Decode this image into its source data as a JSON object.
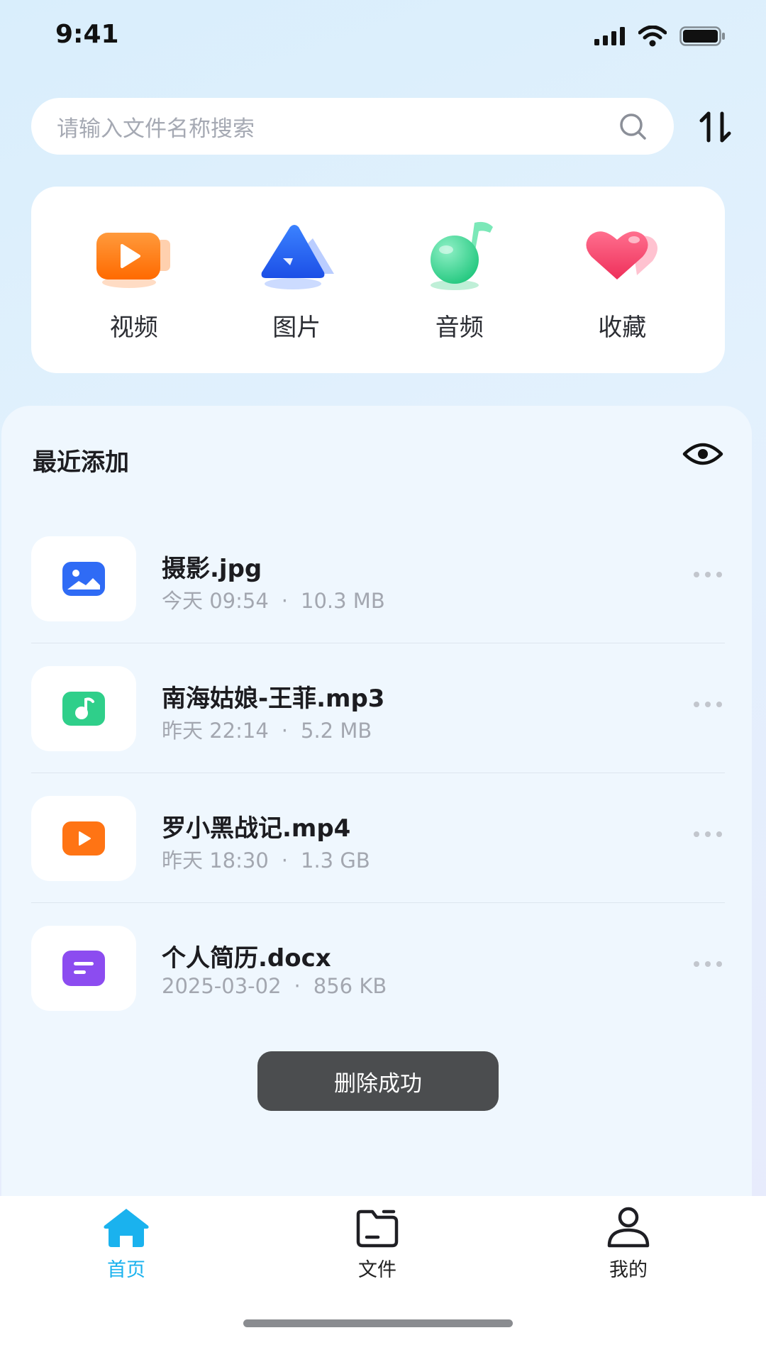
{
  "status": {
    "time": "9:41"
  },
  "search": {
    "placeholder": "请输入文件名称搜索"
  },
  "categories": [
    {
      "label": "视频",
      "icon": "video-icon"
    },
    {
      "label": "图片",
      "icon": "image-icon"
    },
    {
      "label": "音频",
      "icon": "audio-icon"
    },
    {
      "label": "收藏",
      "icon": "heart-icon"
    }
  ],
  "recent": {
    "title": "最近添加",
    "files": [
      {
        "name": "摄影.jpg",
        "time": "今天 09:54",
        "size": "10.3 MB",
        "type": "image",
        "color": "#2f6bf5"
      },
      {
        "name": "南海姑娘-王菲.mp3",
        "time": "昨天 22:14",
        "size": "5.2 MB",
        "type": "audio",
        "color": "#2fcf8a"
      },
      {
        "name": "罗小黑战记.mp4",
        "time": "昨天 18:30",
        "size": "1.3 GB",
        "type": "video",
        "color": "#ff7414"
      },
      {
        "name": "个人简历.docx",
        "time": "2025-03-02",
        "size": "856 KB",
        "type": "document",
        "color": "#8c4cf0"
      }
    ],
    "separator": "·"
  },
  "toast": {
    "message": "删除成功"
  },
  "nav": {
    "items": [
      {
        "label": "首页",
        "icon": "home-icon",
        "active": true
      },
      {
        "label": "文件",
        "icon": "folder-icon",
        "active": false
      },
      {
        "label": "我的",
        "icon": "user-icon",
        "active": false
      }
    ]
  },
  "colors": {
    "accent": "#1ab2ee",
    "toast_bg": "#4b4d4f"
  }
}
